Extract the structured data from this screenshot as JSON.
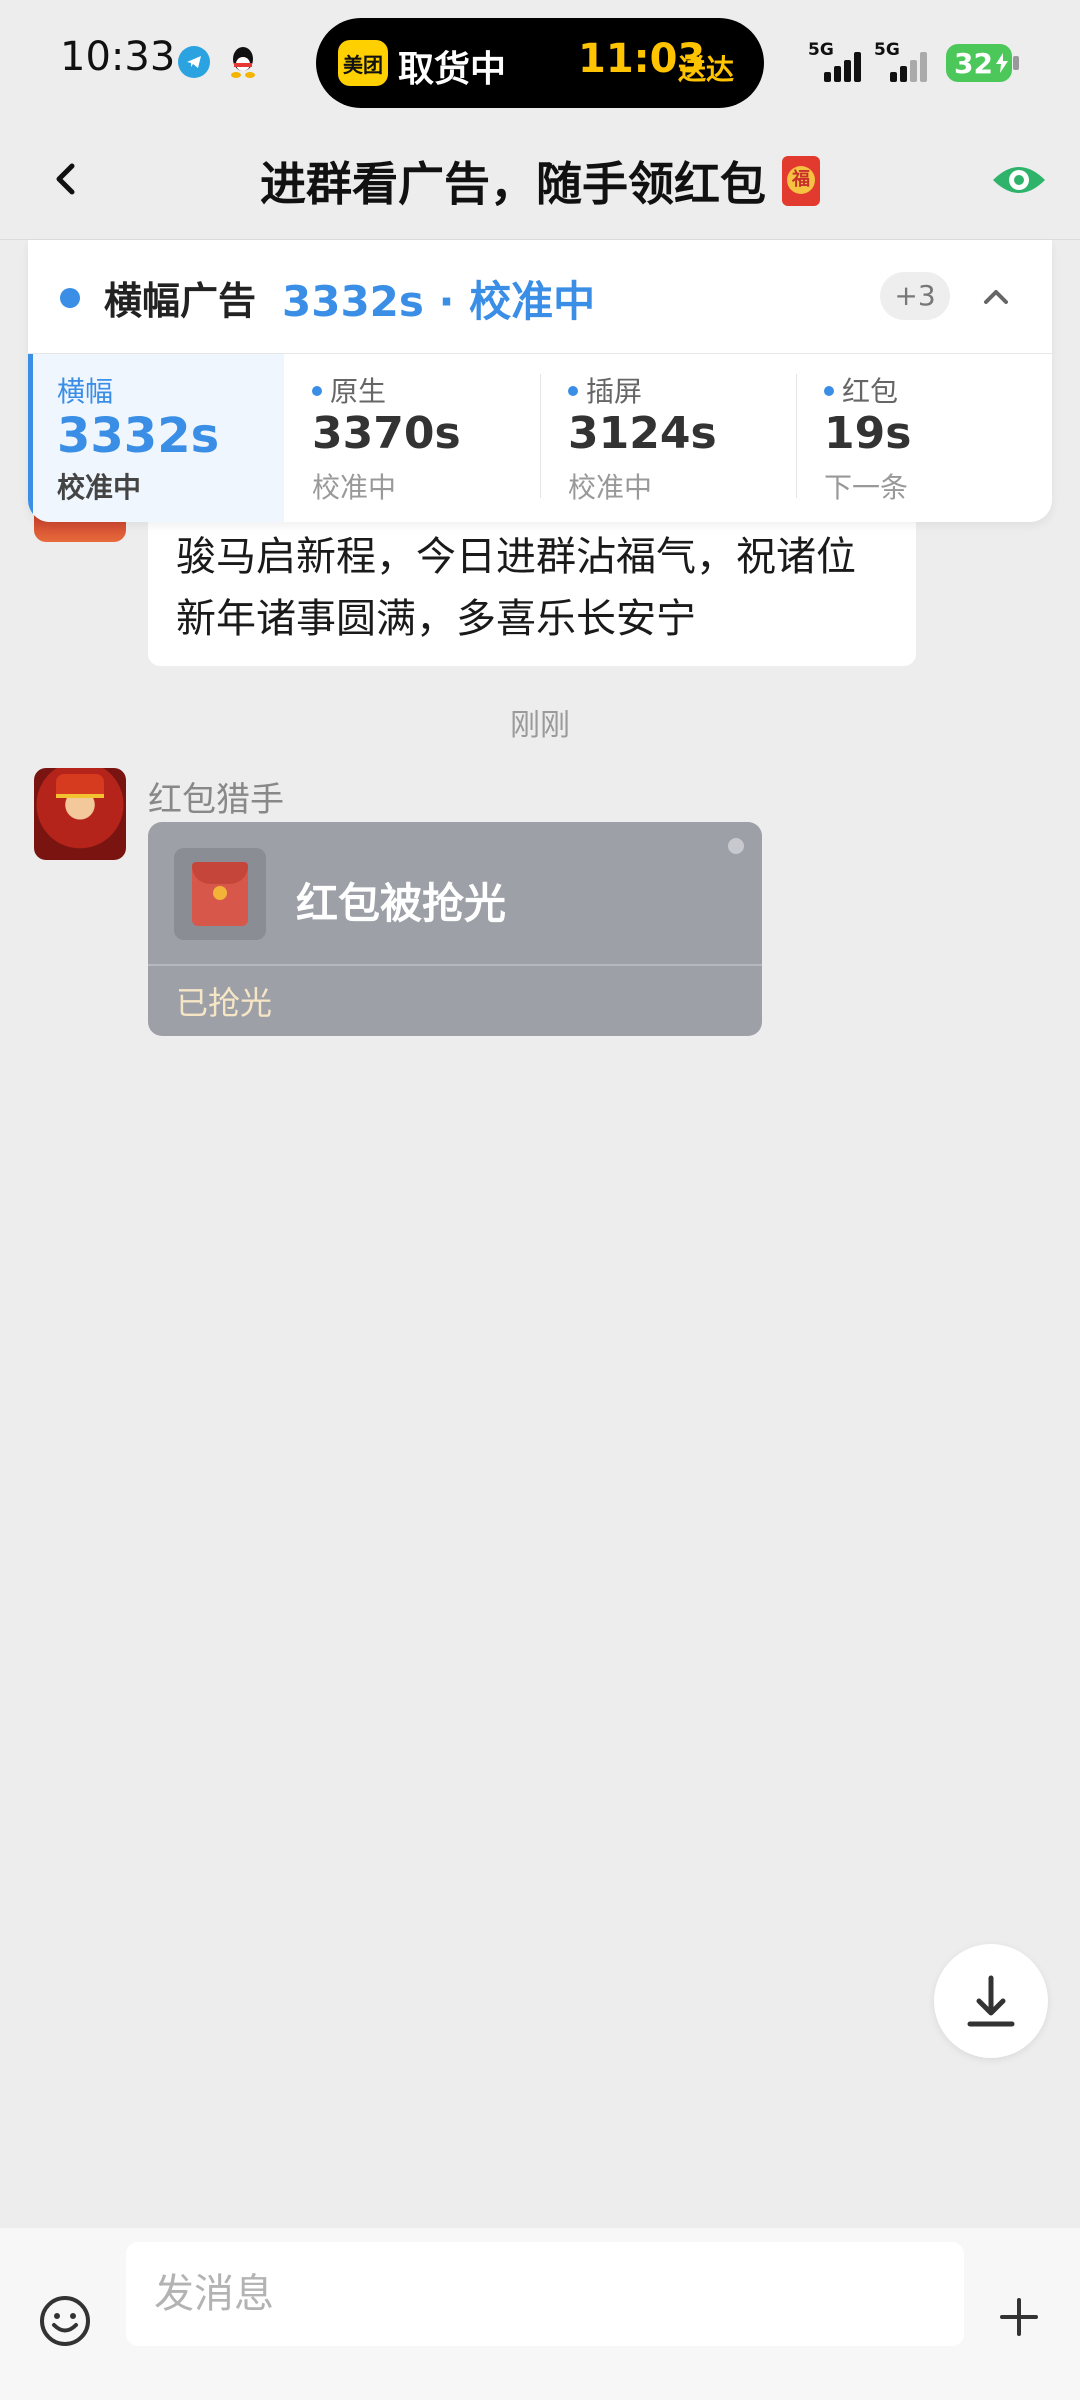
{
  "status_bar": {
    "time": "10:33",
    "island": {
      "app": "美团",
      "status": "取货中",
      "eta_time": "11:03",
      "eta_label": "送达"
    },
    "signal_1": "5G",
    "signal_2": "5G",
    "battery": "32",
    "icons": [
      "telegram-icon",
      "qq-icon"
    ]
  },
  "nav": {
    "title": "进群看广告，随手领红包",
    "title_emoji": "red-envelope-icon",
    "eye_color": "#2fb36b"
  },
  "ad_panel": {
    "name": "横幅广告",
    "countdown": "3332s · 校准中",
    "more_badge": "+3",
    "tabs": [
      {
        "label": "横幅",
        "value": "3332s",
        "sub": "校准中"
      },
      {
        "label": "原生",
        "value": "3370s",
        "sub": "校准中"
      },
      {
        "label": "插屏",
        "value": "3124s",
        "sub": "校准中"
      },
      {
        "label": "红包",
        "value": "19s",
        "sub": "下一条"
      }
    ],
    "accent": "#3a8ee6"
  },
  "messages": {
    "first_text": "骏马启新程，今日进群沾福气，祝诸位新年诸事圆满，多喜乐长安宁",
    "timestamp": "刚刚",
    "sender": "红包猎手",
    "packet": {
      "title": "红包被抢光",
      "status": "已抢光"
    }
  },
  "input": {
    "placeholder": "发消息"
  }
}
